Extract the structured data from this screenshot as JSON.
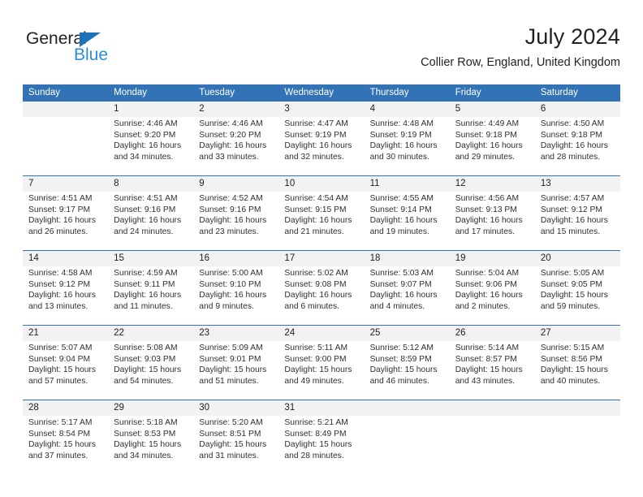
{
  "logo": {
    "word1": "General",
    "word2": "Blue",
    "triangle_color": "#1f72b8",
    "word2_color": "#2a8fd4"
  },
  "header": {
    "title": "July 2024",
    "subtitle": "Collier Row, England, United Kingdom"
  },
  "theme": {
    "header_bar": "#3173b5",
    "daynum_bg": "#f2f2f2",
    "text": "#303030"
  },
  "weekdays": [
    "Sunday",
    "Monday",
    "Tuesday",
    "Wednesday",
    "Thursday",
    "Friday",
    "Saturday"
  ],
  "weeks": [
    {
      "days": [
        {
          "num": "",
          "l1": "",
          "l2": "",
          "l3": "",
          "l4": ""
        },
        {
          "num": "1",
          "l1": "Sunrise: 4:46 AM",
          "l2": "Sunset: 9:20 PM",
          "l3": "Daylight: 16 hours",
          "l4": "and 34 minutes."
        },
        {
          "num": "2",
          "l1": "Sunrise: 4:46 AM",
          "l2": "Sunset: 9:20 PM",
          "l3": "Daylight: 16 hours",
          "l4": "and 33 minutes."
        },
        {
          "num": "3",
          "l1": "Sunrise: 4:47 AM",
          "l2": "Sunset: 9:19 PM",
          "l3": "Daylight: 16 hours",
          "l4": "and 32 minutes."
        },
        {
          "num": "4",
          "l1": "Sunrise: 4:48 AM",
          "l2": "Sunset: 9:19 PM",
          "l3": "Daylight: 16 hours",
          "l4": "and 30 minutes."
        },
        {
          "num": "5",
          "l1": "Sunrise: 4:49 AM",
          "l2": "Sunset: 9:18 PM",
          "l3": "Daylight: 16 hours",
          "l4": "and 29 minutes."
        },
        {
          "num": "6",
          "l1": "Sunrise: 4:50 AM",
          "l2": "Sunset: 9:18 PM",
          "l3": "Daylight: 16 hours",
          "l4": "and 28 minutes."
        }
      ]
    },
    {
      "days": [
        {
          "num": "7",
          "l1": "Sunrise: 4:51 AM",
          "l2": "Sunset: 9:17 PM",
          "l3": "Daylight: 16 hours",
          "l4": "and 26 minutes."
        },
        {
          "num": "8",
          "l1": "Sunrise: 4:51 AM",
          "l2": "Sunset: 9:16 PM",
          "l3": "Daylight: 16 hours",
          "l4": "and 24 minutes."
        },
        {
          "num": "9",
          "l1": "Sunrise: 4:52 AM",
          "l2": "Sunset: 9:16 PM",
          "l3": "Daylight: 16 hours",
          "l4": "and 23 minutes."
        },
        {
          "num": "10",
          "l1": "Sunrise: 4:54 AM",
          "l2": "Sunset: 9:15 PM",
          "l3": "Daylight: 16 hours",
          "l4": "and 21 minutes."
        },
        {
          "num": "11",
          "l1": "Sunrise: 4:55 AM",
          "l2": "Sunset: 9:14 PM",
          "l3": "Daylight: 16 hours",
          "l4": "and 19 minutes."
        },
        {
          "num": "12",
          "l1": "Sunrise: 4:56 AM",
          "l2": "Sunset: 9:13 PM",
          "l3": "Daylight: 16 hours",
          "l4": "and 17 minutes."
        },
        {
          "num": "13",
          "l1": "Sunrise: 4:57 AM",
          "l2": "Sunset: 9:12 PM",
          "l3": "Daylight: 16 hours",
          "l4": "and 15 minutes."
        }
      ]
    },
    {
      "days": [
        {
          "num": "14",
          "l1": "Sunrise: 4:58 AM",
          "l2": "Sunset: 9:12 PM",
          "l3": "Daylight: 16 hours",
          "l4": "and 13 minutes."
        },
        {
          "num": "15",
          "l1": "Sunrise: 4:59 AM",
          "l2": "Sunset: 9:11 PM",
          "l3": "Daylight: 16 hours",
          "l4": "and 11 minutes."
        },
        {
          "num": "16",
          "l1": "Sunrise: 5:00 AM",
          "l2": "Sunset: 9:10 PM",
          "l3": "Daylight: 16 hours",
          "l4": "and 9 minutes."
        },
        {
          "num": "17",
          "l1": "Sunrise: 5:02 AM",
          "l2": "Sunset: 9:08 PM",
          "l3": "Daylight: 16 hours",
          "l4": "and 6 minutes."
        },
        {
          "num": "18",
          "l1": "Sunrise: 5:03 AM",
          "l2": "Sunset: 9:07 PM",
          "l3": "Daylight: 16 hours",
          "l4": "and 4 minutes."
        },
        {
          "num": "19",
          "l1": "Sunrise: 5:04 AM",
          "l2": "Sunset: 9:06 PM",
          "l3": "Daylight: 16 hours",
          "l4": "and 2 minutes."
        },
        {
          "num": "20",
          "l1": "Sunrise: 5:05 AM",
          "l2": "Sunset: 9:05 PM",
          "l3": "Daylight: 15 hours",
          "l4": "and 59 minutes."
        }
      ]
    },
    {
      "days": [
        {
          "num": "21",
          "l1": "Sunrise: 5:07 AM",
          "l2": "Sunset: 9:04 PM",
          "l3": "Daylight: 15 hours",
          "l4": "and 57 minutes."
        },
        {
          "num": "22",
          "l1": "Sunrise: 5:08 AM",
          "l2": "Sunset: 9:03 PM",
          "l3": "Daylight: 15 hours",
          "l4": "and 54 minutes."
        },
        {
          "num": "23",
          "l1": "Sunrise: 5:09 AM",
          "l2": "Sunset: 9:01 PM",
          "l3": "Daylight: 15 hours",
          "l4": "and 51 minutes."
        },
        {
          "num": "24",
          "l1": "Sunrise: 5:11 AM",
          "l2": "Sunset: 9:00 PM",
          "l3": "Daylight: 15 hours",
          "l4": "and 49 minutes."
        },
        {
          "num": "25",
          "l1": "Sunrise: 5:12 AM",
          "l2": "Sunset: 8:59 PM",
          "l3": "Daylight: 15 hours",
          "l4": "and 46 minutes."
        },
        {
          "num": "26",
          "l1": "Sunrise: 5:14 AM",
          "l2": "Sunset: 8:57 PM",
          "l3": "Daylight: 15 hours",
          "l4": "and 43 minutes."
        },
        {
          "num": "27",
          "l1": "Sunrise: 5:15 AM",
          "l2": "Sunset: 8:56 PM",
          "l3": "Daylight: 15 hours",
          "l4": "and 40 minutes."
        }
      ]
    },
    {
      "days": [
        {
          "num": "28",
          "l1": "Sunrise: 5:17 AM",
          "l2": "Sunset: 8:54 PM",
          "l3": "Daylight: 15 hours",
          "l4": "and 37 minutes."
        },
        {
          "num": "29",
          "l1": "Sunrise: 5:18 AM",
          "l2": "Sunset: 8:53 PM",
          "l3": "Daylight: 15 hours",
          "l4": "and 34 minutes."
        },
        {
          "num": "30",
          "l1": "Sunrise: 5:20 AM",
          "l2": "Sunset: 8:51 PM",
          "l3": "Daylight: 15 hours",
          "l4": "and 31 minutes."
        },
        {
          "num": "31",
          "l1": "Sunrise: 5:21 AM",
          "l2": "Sunset: 8:49 PM",
          "l3": "Daylight: 15 hours",
          "l4": "and 28 minutes."
        },
        {
          "num": "",
          "l1": "",
          "l2": "",
          "l3": "",
          "l4": ""
        },
        {
          "num": "",
          "l1": "",
          "l2": "",
          "l3": "",
          "l4": ""
        },
        {
          "num": "",
          "l1": "",
          "l2": "",
          "l3": "",
          "l4": ""
        }
      ]
    }
  ]
}
